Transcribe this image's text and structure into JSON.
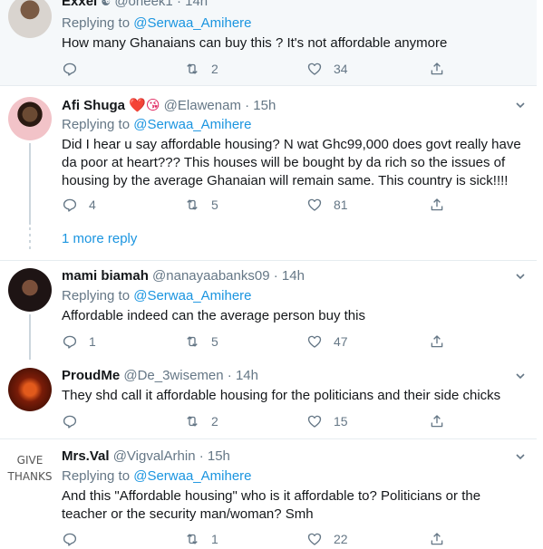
{
  "tweets": [
    {
      "name": "Exxel",
      "handle": "@oneek1",
      "time": "14h",
      "reply_label": "Replying to",
      "reply_handle": "@Serwaa_Amihere",
      "text": "How many Ghanaians can buy this ? It's not affordable anymore",
      "replies": "",
      "retweets": "2",
      "likes": "34"
    },
    {
      "name": "Afi Shuga",
      "emoji": "❤️😘",
      "handle": "@Elawenam",
      "time": "15h",
      "reply_label": "Replying to",
      "reply_handle": "@Serwaa_Amihere",
      "text": "Did I hear u say affordable housing? N wat Ghc99,000 does govt really have da poor at heart??? This houses will be bought by da rich so the issues of housing by the average Ghanaian will remain same.  This country is sick!!!!",
      "replies": "4",
      "retweets": "5",
      "likes": "81",
      "more_replies": "1 more reply"
    },
    {
      "name": "mami biamah",
      "handle": "@nanayaabanks09",
      "time": "14h",
      "reply_label": "Replying to",
      "reply_handle": "@Serwaa_Amihere",
      "text": "Affordable indeed can the average person buy this",
      "replies": "1",
      "retweets": "5",
      "likes": "47"
    },
    {
      "name": "ProudMe",
      "handle": "@De_3wisemen",
      "time": "14h",
      "text": "They shd call it affordable housing for the politicians and their side chicks",
      "replies": "",
      "retweets": "2",
      "likes": "15"
    },
    {
      "name": "Mrs.Val",
      "handle": "@VigvalArhin",
      "time": "15h",
      "reply_label": "Replying to",
      "reply_handle": "@Serwaa_Amihere",
      "text": "And this \"Affordable housing\" who is it affordable to? Politicians or the teacher or the security man/woman? Smh",
      "replies": "",
      "retweets": "1",
      "likes": "22",
      "avatar_text": "GIVE THANKS"
    }
  ],
  "dot": "·",
  "colors": {
    "link": "#1b95e0",
    "muted": "#657786",
    "text": "#14171a"
  },
  "icons": [
    "reply-icon",
    "retweet-icon",
    "like-icon",
    "share-icon",
    "chevron-down-icon"
  ]
}
